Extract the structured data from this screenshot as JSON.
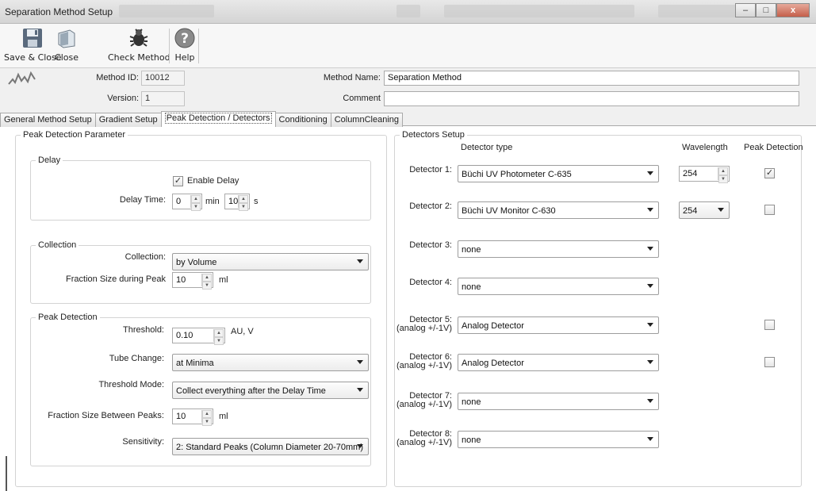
{
  "window": {
    "title": "Separation Method Setup",
    "minimize": "–",
    "maximize": "□",
    "close": "x"
  },
  "toolbar": {
    "save_close": "Save & Close",
    "close": "Close",
    "check_method": "Check Method",
    "help": "Help"
  },
  "header": {
    "method_id_label": "Method ID:",
    "method_id": "10012",
    "version_label": "Version:",
    "version": "1",
    "method_name_label": "Method Name:",
    "method_name": "Separation Method",
    "comment_label": "Comment",
    "comment": ""
  },
  "tabs": [
    {
      "label": "General Method Setup"
    },
    {
      "label": "Gradient Setup"
    },
    {
      "label": "Peak Detection / Detectors"
    },
    {
      "label": "Conditioning"
    },
    {
      "label": "ColumnCleaning"
    }
  ],
  "peak_param": {
    "title": "Peak Detection Parameter",
    "delay": {
      "title": "Delay",
      "enable_label": "Enable Delay",
      "enable_checked": true,
      "time_label": "Delay Time:",
      "minutes": "0",
      "min_unit": "min",
      "seconds": "10",
      "sec_unit": "s"
    },
    "collection": {
      "title": "Collection",
      "collection_label": "Collection:",
      "collection_value": "by Volume",
      "fraction_label": "Fraction Size during Peak",
      "fraction_value": "10",
      "fraction_unit": "ml"
    },
    "peak": {
      "title": "Peak Detection",
      "threshold_label": "Threshold:",
      "threshold_value": "0.10",
      "threshold_unit": "AU, V",
      "tube_label": "Tube Change:",
      "tube_value": "at Minima",
      "mode_label": "Threshold Mode:",
      "mode_value": "Collect everything after the Delay Time",
      "between_label": "Fraction Size Between Peaks:",
      "between_value": "10",
      "between_unit": "ml",
      "sens_label": "Sensitivity:",
      "sens_value": "2: Standard Peaks (Column Diameter 20-70mm)"
    }
  },
  "detectors": {
    "title": "Detectors Setup",
    "col_type": "Detector type",
    "col_wavelength": "Wavelength",
    "col_peak": "Peak Detection",
    "rows": [
      {
        "label": "Detector 1:",
        "sub": "",
        "type": "Büchi UV Photometer C-635",
        "wavelength": "254",
        "wl_kind": "spin",
        "peak": true
      },
      {
        "label": "Detector 2:",
        "sub": "",
        "type": "Büchi UV Monitor C-630",
        "wavelength": "254",
        "wl_kind": "combo",
        "peak": false
      },
      {
        "label": "Detector 3:",
        "sub": "",
        "type": "none",
        "wavelength": "",
        "wl_kind": "",
        "peak": null
      },
      {
        "label": "Detector 4:",
        "sub": "",
        "type": "none",
        "wavelength": "",
        "wl_kind": "",
        "peak": null
      },
      {
        "label": "Detector 5:",
        "sub": "(analog +/-1V)",
        "type": "Analog Detector",
        "wavelength": "",
        "wl_kind": "",
        "peak": false
      },
      {
        "label": "Detector 6:",
        "sub": "(analog +/-1V)",
        "type": "Analog Detector",
        "wavelength": "",
        "wl_kind": "",
        "peak": false
      },
      {
        "label": "Detector 7:",
        "sub": "(analog +/-1V)",
        "type": "none",
        "wavelength": "",
        "wl_kind": "",
        "peak": null
      },
      {
        "label": "Detector 8:",
        "sub": "(analog +/-1V)",
        "type": "none",
        "wavelength": "",
        "wl_kind": "",
        "peak": null
      }
    ]
  }
}
